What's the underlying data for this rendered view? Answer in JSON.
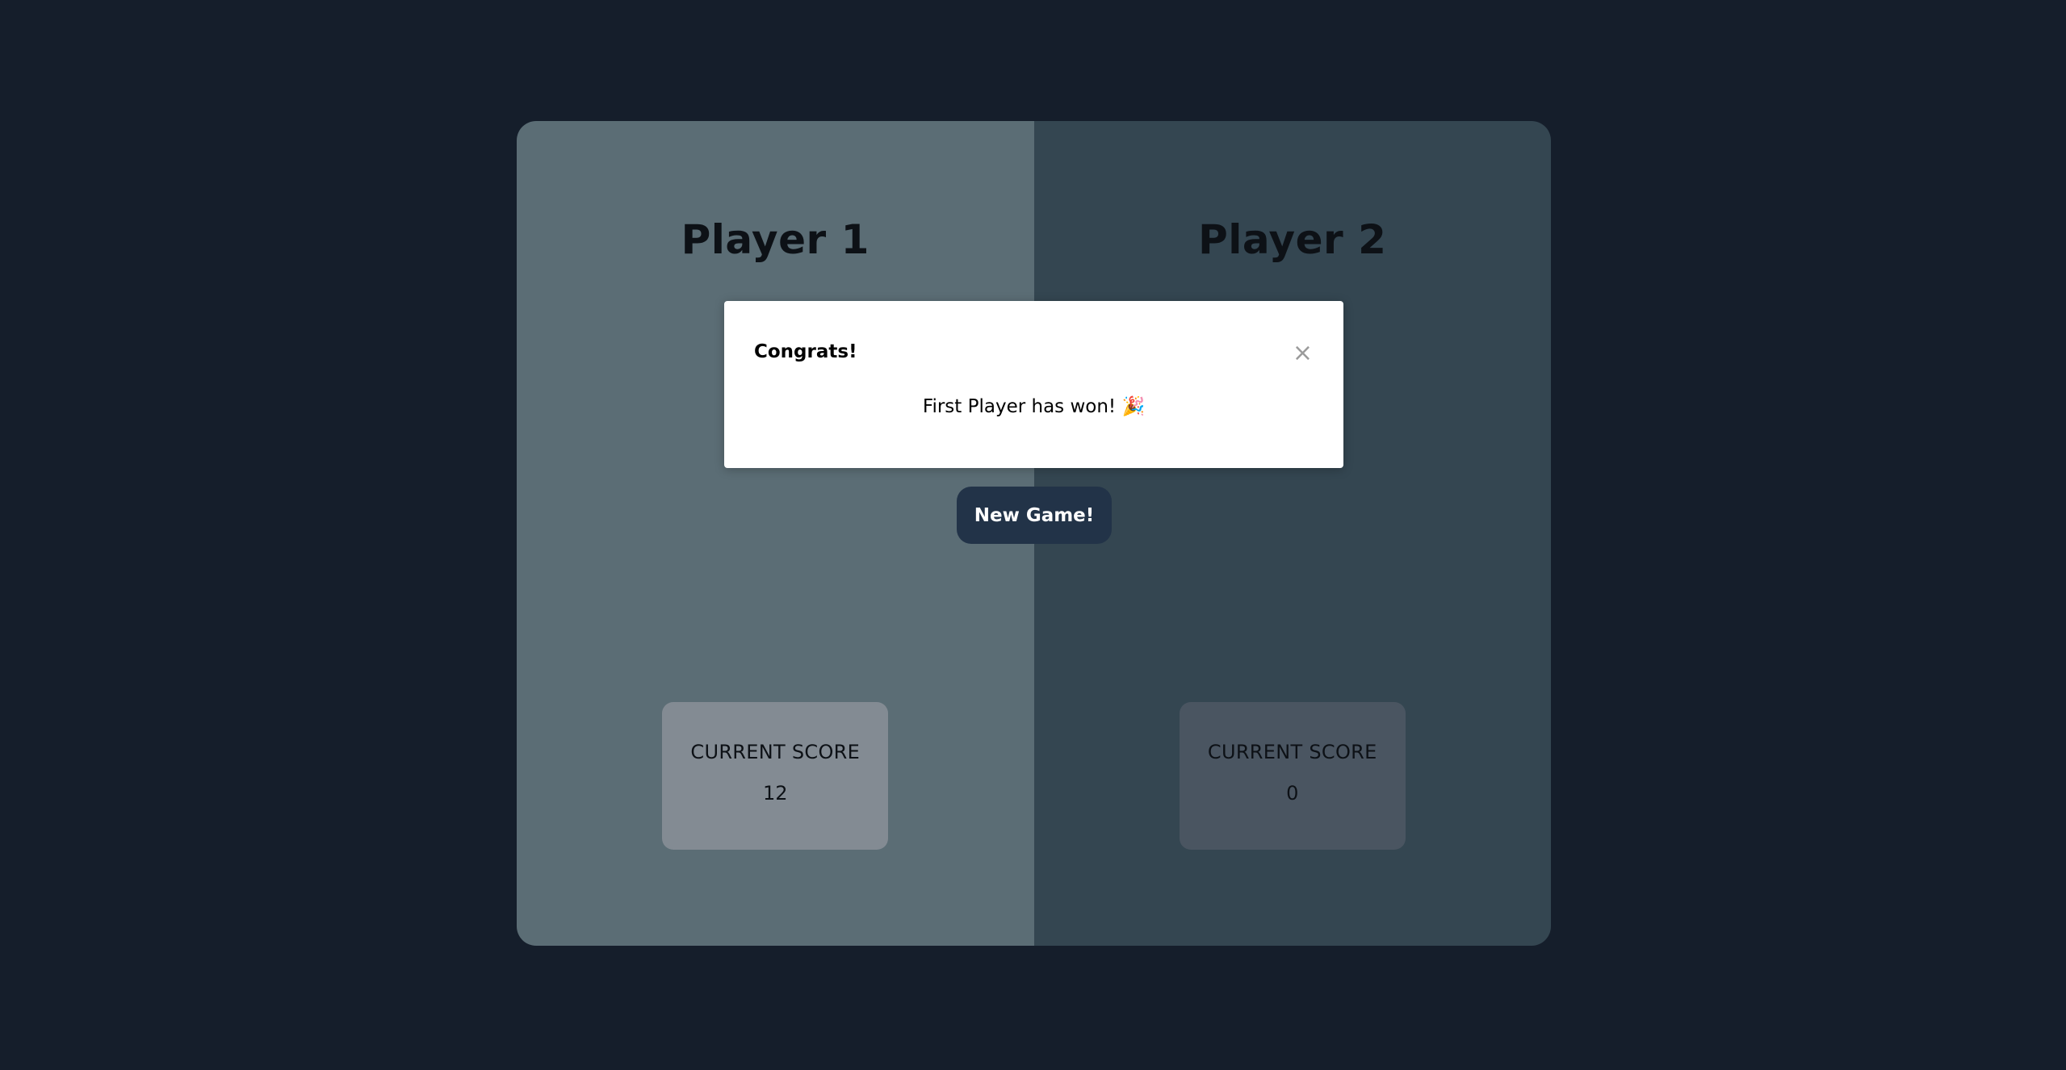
{
  "players": [
    {
      "name": "Player 1",
      "score_label": "CURRENT SCORE",
      "current_score": "12",
      "active": true
    },
    {
      "name": "Player 2",
      "score_label": "CURRENT SCORE",
      "current_score": "0",
      "active": false
    }
  ],
  "controls": {
    "new_game_label": "New Game!"
  },
  "modal": {
    "title": "Congrats!",
    "close_symbol": "×",
    "message": "First Player has won! 🎉"
  },
  "colors": {
    "background": "#151e2b",
    "active_panel": "#5b6d75",
    "inactive_panel": "#344651",
    "button": "#223348",
    "modal": "#ffffff"
  },
  "icons": {
    "close": "close-icon",
    "celebration": "party-popper-icon"
  }
}
